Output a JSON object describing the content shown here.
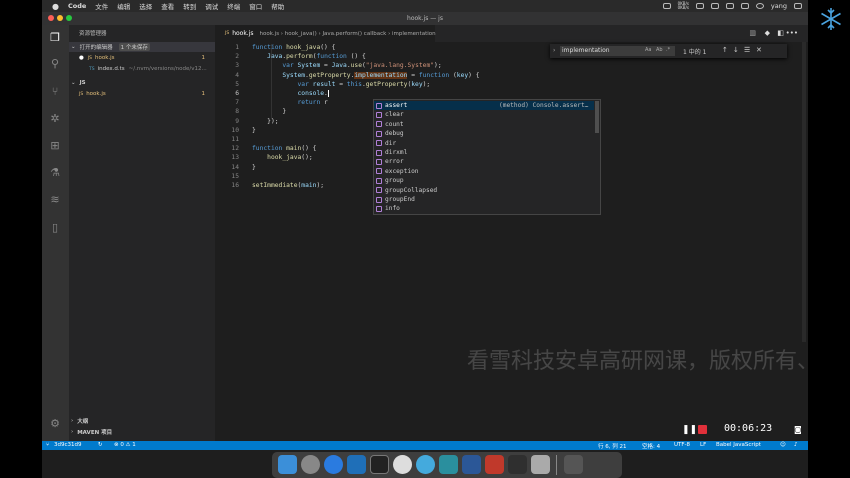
{
  "menubar": {
    "apple": "",
    "items": [
      "Code",
      "文件",
      "编辑",
      "选择",
      "查看",
      "转到",
      "调试",
      "终端",
      "窗口",
      "帮助"
    ],
    "user": "yang",
    "net_speed": "0KB/s\n0KB/s"
  },
  "window": {
    "title": "hook.js — js"
  },
  "sidebar": {
    "explorer_title": "资源管理器",
    "open_editors_label": "打开的编辑器",
    "unsaved_badge": "1 个未保存",
    "open_files": [
      {
        "name": "hook.js",
        "count": "1"
      },
      {
        "name": "index.d.ts",
        "path": "~/.nvm/versions/node/v12..."
      }
    ],
    "folder_label": "JS",
    "folder_files": [
      {
        "name": "hook.js",
        "count": "1"
      }
    ],
    "outline_label": "大纲",
    "maven_label": "MAVEN 项目"
  },
  "editor": {
    "tab_name": "hook.js",
    "breadcrumb": [
      "hook.js",
      "hook_java()",
      "Java.perform() callback",
      "implementation"
    ],
    "lines": [
      {
        "n": "1",
        "text": "function hook_java() {"
      },
      {
        "n": "2",
        "text": "    Java.perform(function () {"
      },
      {
        "n": "3",
        "text": "        var System = Java.use(\"java.lang.System\");"
      },
      {
        "n": "4",
        "text": "        System.getProperty.implementation = function (key) {"
      },
      {
        "n": "5",
        "text": "            var result = this.getProperty(key);"
      },
      {
        "n": "6",
        "text": "            console."
      },
      {
        "n": "7",
        "text": "            return r"
      },
      {
        "n": "8",
        "text": "        }"
      },
      {
        "n": "9",
        "text": "    });"
      },
      {
        "n": "10",
        "text": "}"
      },
      {
        "n": "11",
        "text": ""
      },
      {
        "n": "12",
        "text": "function main() {"
      },
      {
        "n": "13",
        "text": "    hook_java();"
      },
      {
        "n": "14",
        "text": "}"
      },
      {
        "n": "15",
        "text": ""
      },
      {
        "n": "16",
        "text": "setImmediate(main);"
      }
    ],
    "find": {
      "value": "implementation",
      "opt1": "Aa",
      "opt2": "Ab",
      "opt3": ".*",
      "result": "1 中的 1"
    },
    "suggest": {
      "items": [
        "assert",
        "clear",
        "count",
        "debug",
        "dir",
        "dirxml",
        "error",
        "exception",
        "group",
        "groupCollapsed",
        "groupEnd",
        "info"
      ],
      "detail": "(method) Console.assert…"
    }
  },
  "statusbar": {
    "branch": "3d9c31d9",
    "problems": "⊗ 0 ⚠ 1",
    "position": "行 6, 列 21",
    "spaces": "空格: 4",
    "encoding": "UTF-8",
    "eol": "LF",
    "language": "Babel JavaScript"
  },
  "recorder": {
    "time": "00:06:23"
  },
  "watermark": "看雪科技安卓高研网课，版权所有、盗版",
  "logo_text": "看雪",
  "colors": {
    "accent": "#007acc",
    "record_red": "#e0303a"
  }
}
